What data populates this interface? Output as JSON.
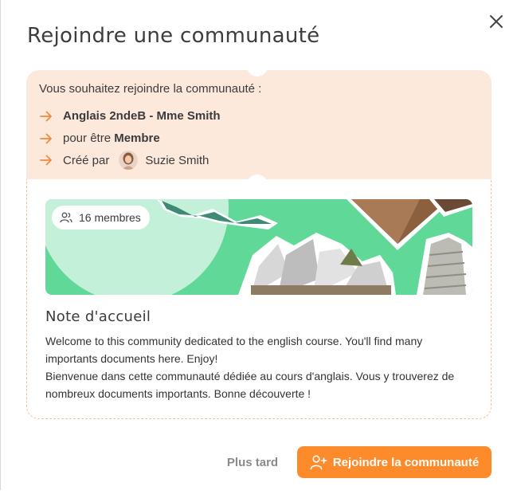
{
  "modal": {
    "title": "Rejoindre une communauté",
    "close_icon": "close-icon"
  },
  "info": {
    "intro": "Vous souhaitez rejoindre la communauté :",
    "community_name": "Anglais 2ndeB - Mme Smith",
    "role_prefix": "pour être",
    "role": "Membre",
    "created_by_label": "Créé par",
    "creator_name": "Suzie Smith",
    "arrow_color": "#f28b3c",
    "background_color": "#fde9dc"
  },
  "banner": {
    "members_label": "16 membres",
    "members_icon": "users-icon",
    "background_color": "#5fd898"
  },
  "welcome_note": {
    "title": "Note d'accueil",
    "text_en": "Welcome to this community dedicated to the english course. You'll find many importants documents here. Enjoy!",
    "text_fr": "Bienvenue dans cette communauté dédiée au cours d'anglais. Vous y trouverez de nombreux documents importants. Bonne découverte !"
  },
  "actions": {
    "later_label": "Plus tard",
    "join_label": "Rejoindre la communauté",
    "join_icon": "add-user-icon",
    "accent_color": "#fd8a2b"
  }
}
